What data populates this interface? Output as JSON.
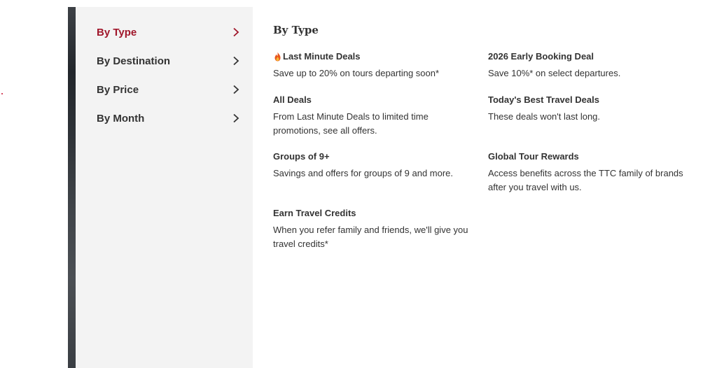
{
  "colors": {
    "accent": "#a0162a",
    "text": "#333333",
    "menu_bg": "#f3f3f3",
    "red_dot": "#c8102e"
  },
  "menu": {
    "items": [
      {
        "label": "By Type",
        "active": true,
        "icon": "chevron-right-icon"
      },
      {
        "label": "By Destination",
        "active": false,
        "icon": "chevron-right-icon"
      },
      {
        "label": "By Price",
        "active": false,
        "icon": "chevron-right-icon"
      },
      {
        "label": "By Month",
        "active": false,
        "icon": "chevron-right-icon"
      }
    ]
  },
  "content": {
    "title": "By Type",
    "deals": [
      {
        "title": "Last Minute Deals",
        "icon": "fire-icon",
        "desc": "Save up to 20% on tours departing soon*"
      },
      {
        "title": "2026 Early Booking Deal",
        "desc": "Save 10%* on select departures."
      },
      {
        "title": "All Deals",
        "desc": "From Last Minute Deals to limited time promotions, see all offers."
      },
      {
        "title": "Today's Best Travel Deals",
        "desc": "These deals won't last long."
      },
      {
        "title": "Groups of 9+",
        "desc": "Savings and offers for groups of 9 and more."
      },
      {
        "title": "Global Tour Rewards",
        "desc": "Access benefits across the TTC family of brands after you travel with us."
      },
      {
        "title": "Earn Travel Credits",
        "desc": "When you refer family and friends, we'll give you travel credits*"
      }
    ]
  }
}
